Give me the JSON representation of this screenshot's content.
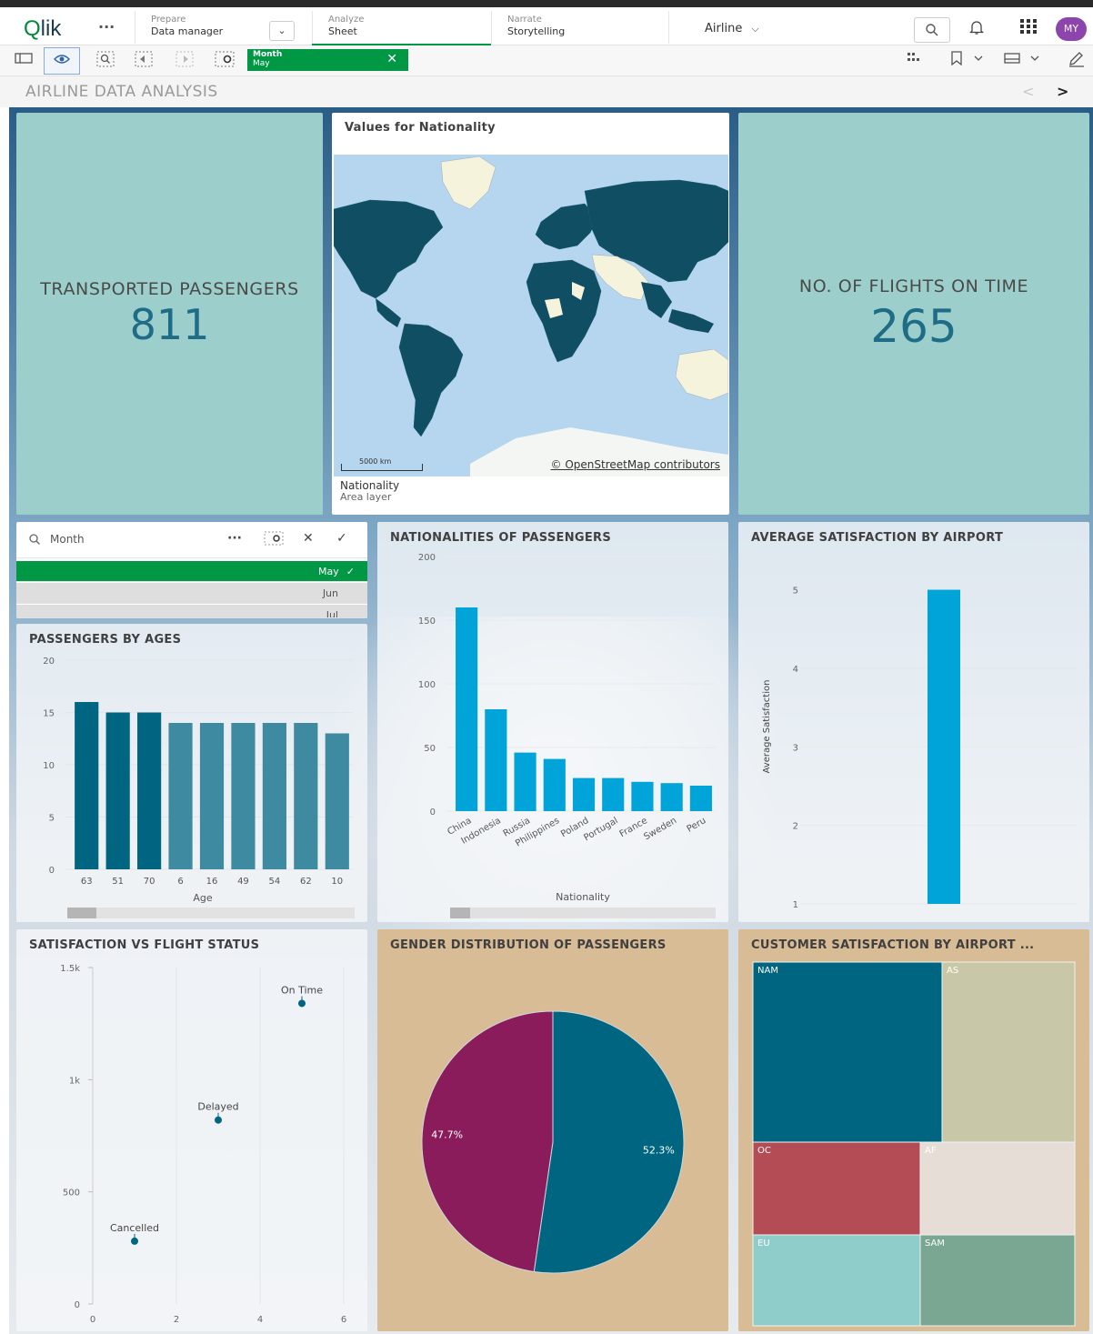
{
  "nav": {
    "logo": "Qlik",
    "more": "···",
    "prepare": {
      "small": "Prepare",
      "big": "Data manager"
    },
    "analyze": {
      "small": "Analyze",
      "big": "Sheet"
    },
    "narrate": {
      "small": "Narrate",
      "big": "Storytelling"
    },
    "app_name": "Airline",
    "avatar": "MY"
  },
  "selection": {
    "field": "Month",
    "value": "May"
  },
  "sheet_title": "AIRLINE DATA ANALYSIS",
  "kpi_passengers": {
    "label": "TRANSPORTED PASSENGERS",
    "value": "811"
  },
  "kpi_flights": {
    "label": "NO. OF FLIGHTS ON TIME",
    "value": "265"
  },
  "map": {
    "title": "Values for Nationality",
    "scale": "5000 km",
    "attribution": "© OpenStreetMap contributors",
    "layer_title": "Nationality",
    "layer_sub": "Area layer"
  },
  "filter": {
    "label": "Month",
    "items": [
      "May",
      "Jun",
      "Jul"
    ],
    "selected": "May"
  },
  "colors": {
    "kpi_bg": "#9ccfcb",
    "kpi_value": "#1f6c87",
    "bar_blue": "#00a4d8",
    "dark_teal": "#006580",
    "mid_teal": "#3e8aa0",
    "female": "#8b1c5c",
    "male": "#006580",
    "selection_green": "#009845"
  },
  "charts": {
    "ages": {
      "title": "PASSENGERS BY AGES",
      "xlabel": "Age",
      "yticks": [
        "0",
        "5",
        "10",
        "15",
        "20"
      ]
    },
    "nationalities": {
      "title": "NATIONALITIES OF PASSENGERS",
      "xlabel": "Nationality",
      "yticks": [
        "0",
        "50",
        "100",
        "150",
        "200"
      ]
    },
    "satisfaction_airport": {
      "title": "AVERAGE SATISFACTION BY AIRPORT",
      "ylabel": "Average Satisfaction",
      "yticks": [
        "1",
        "2",
        "3",
        "4",
        "5"
      ]
    },
    "flight_status": {
      "title": "SATISFACTION VS FLIGHT STATUS",
      "yticks": [
        "0",
        "500",
        "1k",
        "1.5k"
      ],
      "xticks": [
        "0",
        "2",
        "4",
        "6"
      ]
    },
    "gender": {
      "title": "GENDER DISTRIBUTION OF PASSENGERS"
    },
    "treemap": {
      "title": "CUSTOMER SATISFACTION BY AIRPORT ..."
    }
  },
  "chart_data": [
    {
      "type": "bar",
      "title": "PASSENGERS BY AGES",
      "xlabel": "Age",
      "ylabel": "",
      "categories": [
        "63",
        "51",
        "70",
        "6",
        "16",
        "49",
        "54",
        "62",
        "10"
      ],
      "values": [
        16,
        15,
        15,
        14,
        14,
        14,
        14,
        14,
        13
      ],
      "ylim": [
        0,
        20
      ]
    },
    {
      "type": "bar",
      "title": "NATIONALITIES OF PASSENGERS",
      "xlabel": "Nationality",
      "ylabel": "",
      "categories": [
        "China",
        "Indonesia",
        "Russia",
        "Philippines",
        "Poland",
        "Portugal",
        "France",
        "Sweden",
        "Peru"
      ],
      "values": [
        160,
        80,
        46,
        41,
        26,
        26,
        23,
        22,
        20
      ],
      "ylim": [
        0,
        200
      ]
    },
    {
      "type": "bar",
      "title": "AVERAGE SATISFACTION BY AIRPORT",
      "xlabel": "",
      "ylabel": "Average Satisfaction",
      "categories": [
        ""
      ],
      "values": [
        5
      ],
      "ylim": [
        1,
        5.4
      ]
    },
    {
      "type": "scatter",
      "title": "SATISFACTION VS FLIGHT STATUS",
      "points": [
        {
          "label": "Cancelled",
          "x": 1,
          "y": 280
        },
        {
          "label": "Delayed",
          "x": 3,
          "y": 820
        },
        {
          "label": "On Time",
          "x": 5,
          "y": 1340
        }
      ],
      "xlim": [
        0,
        6
      ],
      "ylim": [
        0,
        1500
      ]
    },
    {
      "type": "pie",
      "title": "GENDER DISTRIBUTION OF PASSENGERS",
      "labels": [
        "52.3%",
        "47.7%"
      ],
      "values": [
        52.3,
        47.7
      ]
    },
    {
      "type": "treemap",
      "title": "CUSTOMER SATISFACTION BY AIRPORT ...",
      "labels": [
        "NAM",
        "AS",
        "OC",
        "AF",
        "EU",
        "SAM"
      ]
    }
  ]
}
